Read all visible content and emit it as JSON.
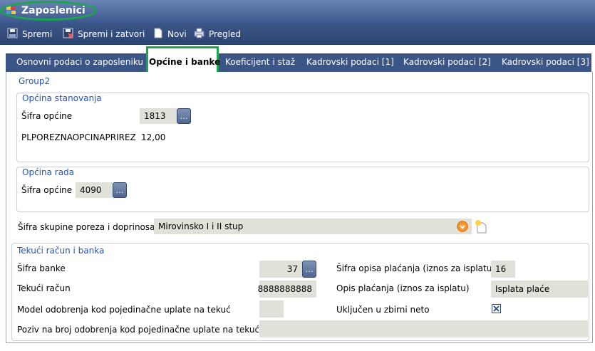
{
  "window": {
    "title": "Zaposlenici"
  },
  "toolbar": {
    "save_label": "Spremi",
    "save_close_label": "Spremi i zatvori",
    "new_label": "Novi",
    "preview_label": "Pregled"
  },
  "tabs": [
    {
      "label": "Osnovni podaci o zaposleniku"
    },
    {
      "label": "Općine i banke"
    },
    {
      "label": "Koeficijent i staž"
    },
    {
      "label": "Kadrovski podaci [1]"
    },
    {
      "label": "Kadrovski podaci [2]"
    },
    {
      "label": "Kadrovski podaci [3]"
    }
  ],
  "group2": {
    "title": "Group2"
  },
  "opcina_stanovanja": {
    "title": "Općina stanovanja",
    "sifra_label": "Šifra općine",
    "sifra_value": "1813",
    "prirez_label": "PLPOREZNAOPCINAPRIREZ",
    "prirez_value": "12,00"
  },
  "opcina_rada": {
    "title": "Općina rada",
    "sifra_label": "Šifra općine",
    "sifra_value": "4090"
  },
  "skupina": {
    "label": "Šifra skupine poreza i doprinosa",
    "value": "Mirovinsko I i II stup"
  },
  "tekuci": {
    "title": "Tekući račun i banka",
    "sifra_banke_label": "Šifra banke",
    "sifra_banke_value": "37",
    "tekuci_racun_label": "Tekući račun",
    "tekuci_racun_value": "8888888888",
    "model_label": "Model odobrenja kod pojedinačne uplate na tekuć",
    "model_value": "",
    "poziv_label": "Poziv na broj odobrenja kod pojedinačne uplate na tekući",
    "poziv_value": "",
    "sifra_opisa_label": "Šifra opisa plaćanja (iznos za isplatu)",
    "sifra_opisa_value": "16",
    "opis_label": "Opis plaćanja (iznos za isplatu)",
    "opis_value": "Isplata plaće",
    "ukljucen_label": "Uključen u zbirni neto",
    "ukljucen_checked": true
  },
  "icons": {
    "app": "app-window-icon",
    "save": "floppy-disk-icon",
    "save_close": "floppy-disk-close-icon",
    "new": "new-document-icon",
    "preview": "print-preview-icon",
    "ellipsis": "ellipsis-icon",
    "dropdown": "chevron-down-icon",
    "new_item": "new-item-sparkle-icon",
    "check": "checkbox-x-icon"
  },
  "colors": {
    "title_bar": "#4a6699",
    "toolbar": "#3b5586",
    "group_title": "#2456b6",
    "field_bg": "#e0e1d8",
    "highlight": "#1aa64a"
  }
}
